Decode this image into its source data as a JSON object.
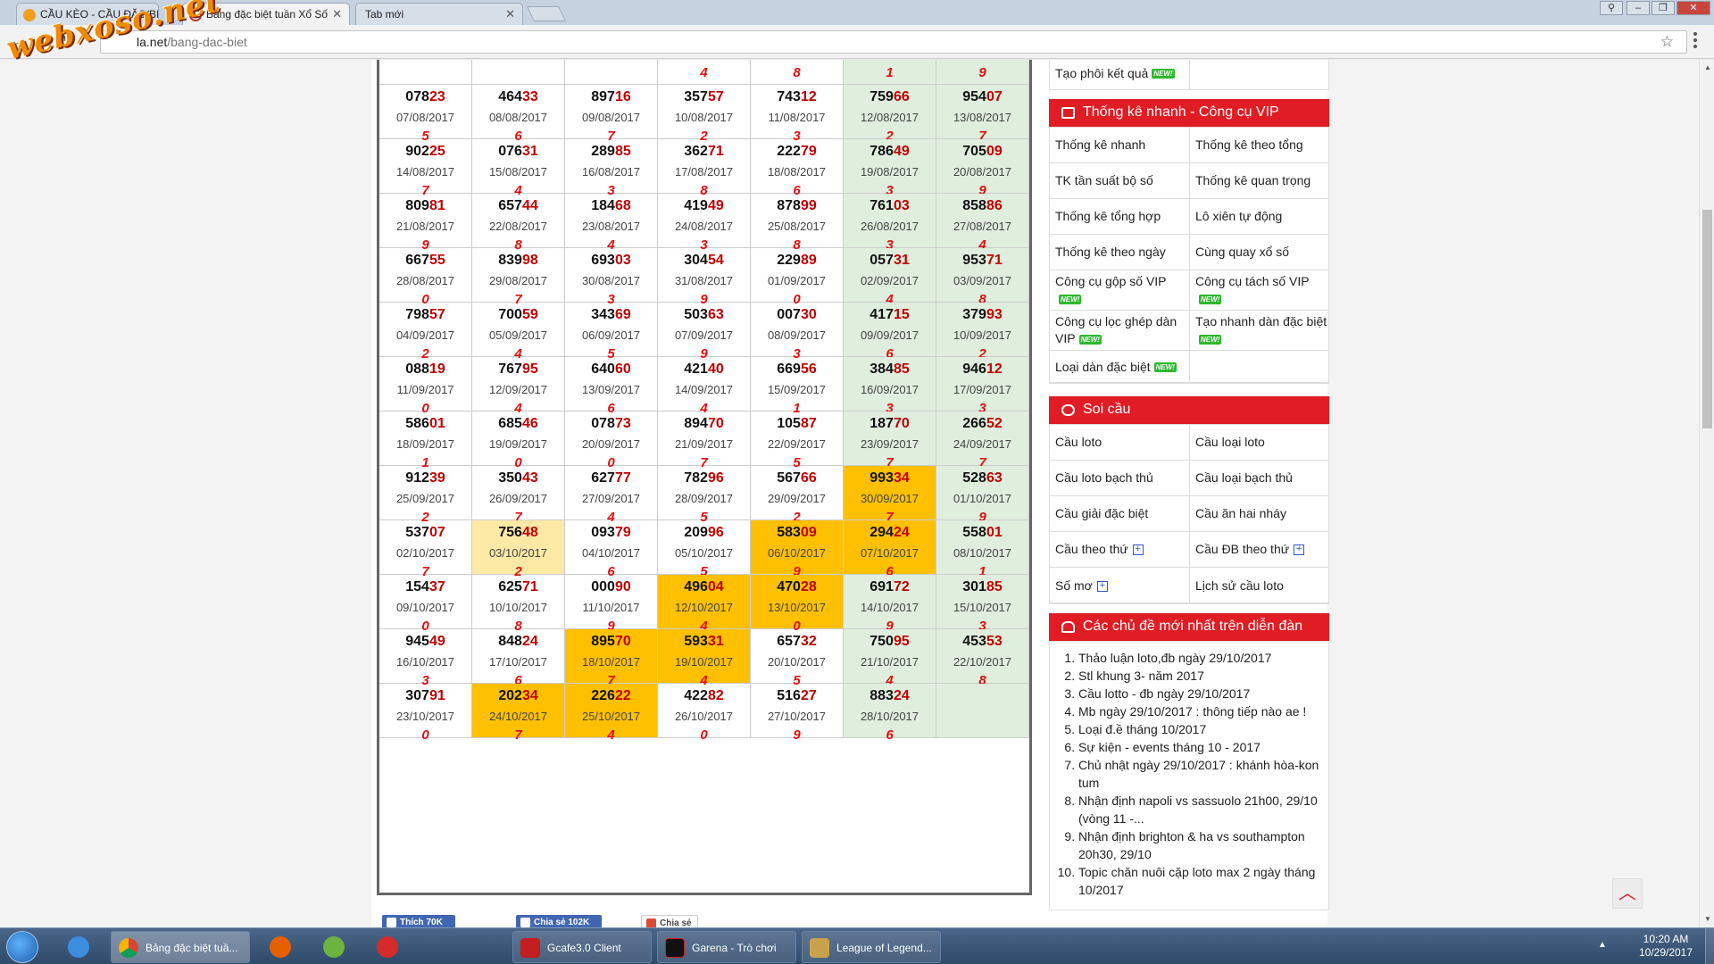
{
  "browser": {
    "tabs": [
      {
        "label": "CẦU KÈO - CẦU ĐẶC BIỆ"
      },
      {
        "label": "Bảng đặc biệt tuần Xổ Số"
      },
      {
        "label": "Tab mới"
      }
    ],
    "url_host": "la.net",
    "url_path": "/bang-dac-biet",
    "watermark": "webxoso.net"
  },
  "table": {
    "top_row_sums": [
      "4",
      "8",
      "1",
      "9"
    ],
    "rows": [
      [
        {
          "n": "07823",
          "d": "07/08/2017",
          "s": "5"
        },
        {
          "n": "46433",
          "d": "08/08/2017",
          "s": "6"
        },
        {
          "n": "89716",
          "d": "09/08/2017",
          "s": "7"
        },
        {
          "n": "35757",
          "d": "10/08/2017",
          "s": "2"
        },
        {
          "n": "74312",
          "d": "11/08/2017",
          "s": "3"
        },
        {
          "n": "75966",
          "d": "12/08/2017",
          "s": "2"
        },
        {
          "n": "95407",
          "d": "13/08/2017",
          "s": "7"
        }
      ],
      [
        {
          "n": "90225",
          "d": "14/08/2017",
          "s": "7"
        },
        {
          "n": "07631",
          "d": "15/08/2017",
          "s": "4"
        },
        {
          "n": "28985",
          "d": "16/08/2017",
          "s": "3"
        },
        {
          "n": "36271",
          "d": "17/08/2017",
          "s": "8"
        },
        {
          "n": "22279",
          "d": "18/08/2017",
          "s": "6"
        },
        {
          "n": "78649",
          "d": "19/08/2017",
          "s": "3"
        },
        {
          "n": "70509",
          "d": "20/08/2017",
          "s": "9"
        }
      ],
      [
        {
          "n": "80981",
          "d": "21/08/2017",
          "s": "9"
        },
        {
          "n": "65744",
          "d": "22/08/2017",
          "s": "8"
        },
        {
          "n": "18468",
          "d": "23/08/2017",
          "s": "4"
        },
        {
          "n": "41949",
          "d": "24/08/2017",
          "s": "3"
        },
        {
          "n": "87899",
          "d": "25/08/2017",
          "s": "8"
        },
        {
          "n": "76103",
          "d": "26/08/2017",
          "s": "3"
        },
        {
          "n": "85886",
          "d": "27/08/2017",
          "s": "4"
        }
      ],
      [
        {
          "n": "66755",
          "d": "28/08/2017",
          "s": "0"
        },
        {
          "n": "83998",
          "d": "29/08/2017",
          "s": "7"
        },
        {
          "n": "69303",
          "d": "30/08/2017",
          "s": "3"
        },
        {
          "n": "30454",
          "d": "31/08/2017",
          "s": "9"
        },
        {
          "n": "22989",
          "d": "01/09/2017",
          "s": "0"
        },
        {
          "n": "05731",
          "d": "02/09/2017",
          "s": "4"
        },
        {
          "n": "95371",
          "d": "03/09/2017",
          "s": "8"
        }
      ],
      [
        {
          "n": "79857",
          "d": "04/09/2017",
          "s": "2"
        },
        {
          "n": "70059",
          "d": "05/09/2017",
          "s": "4"
        },
        {
          "n": "34369",
          "d": "06/09/2017",
          "s": "5"
        },
        {
          "n": "50363",
          "d": "07/09/2017",
          "s": "9"
        },
        {
          "n": "00730",
          "d": "08/09/2017",
          "s": "3"
        },
        {
          "n": "41715",
          "d": "09/09/2017",
          "s": "6"
        },
        {
          "n": "37993",
          "d": "10/09/2017",
          "s": "2"
        }
      ],
      [
        {
          "n": "08819",
          "d": "11/09/2017",
          "s": "0"
        },
        {
          "n": "76795",
          "d": "12/09/2017",
          "s": "4"
        },
        {
          "n": "64060",
          "d": "13/09/2017",
          "s": "6"
        },
        {
          "n": "42140",
          "d": "14/09/2017",
          "s": "4"
        },
        {
          "n": "66956",
          "d": "15/09/2017",
          "s": "1"
        },
        {
          "n": "38485",
          "d": "16/09/2017",
          "s": "3"
        },
        {
          "n": "94612",
          "d": "17/09/2017",
          "s": "3"
        }
      ],
      [
        {
          "n": "58601",
          "d": "18/09/2017",
          "s": "1"
        },
        {
          "n": "68546",
          "d": "19/09/2017",
          "s": "0"
        },
        {
          "n": "07873",
          "d": "20/09/2017",
          "s": "0"
        },
        {
          "n": "89470",
          "d": "21/09/2017",
          "s": "7"
        },
        {
          "n": "10587",
          "d": "22/09/2017",
          "s": "5"
        },
        {
          "n": "18770",
          "d": "23/09/2017",
          "s": "7"
        },
        {
          "n": "26652",
          "d": "24/09/2017",
          "s": "7"
        }
      ],
      [
        {
          "n": "91239",
          "d": "25/09/2017",
          "s": "2"
        },
        {
          "n": "35043",
          "d": "26/09/2017",
          "s": "7"
        },
        {
          "n": "62777",
          "d": "27/09/2017",
          "s": "4"
        },
        {
          "n": "78296",
          "d": "28/09/2017",
          "s": "5"
        },
        {
          "n": "56766",
          "d": "29/09/2017",
          "s": "2"
        },
        {
          "n": "99334",
          "d": "30/09/2017",
          "s": "7",
          "hl": "hl"
        },
        {
          "n": "52863",
          "d": "01/10/2017",
          "s": "9"
        }
      ],
      [
        {
          "n": "53707",
          "d": "02/10/2017",
          "s": "7"
        },
        {
          "n": "75648",
          "d": "03/10/2017",
          "s": "2",
          "hl": "lt"
        },
        {
          "n": "09379",
          "d": "04/10/2017",
          "s": "6"
        },
        {
          "n": "20996",
          "d": "05/10/2017",
          "s": "5"
        },
        {
          "n": "58309",
          "d": "06/10/2017",
          "s": "9",
          "hl": "hl"
        },
        {
          "n": "29424",
          "d": "07/10/2017",
          "s": "6",
          "hl": "hl"
        },
        {
          "n": "55801",
          "d": "08/10/2017",
          "s": "1"
        }
      ],
      [
        {
          "n": "15437",
          "d": "09/10/2017",
          "s": "0"
        },
        {
          "n": "62571",
          "d": "10/10/2017",
          "s": "8"
        },
        {
          "n": "00090",
          "d": "11/10/2017",
          "s": "9"
        },
        {
          "n": "49604",
          "d": "12/10/2017",
          "s": "4",
          "hl": "hl"
        },
        {
          "n": "47028",
          "d": "13/10/2017",
          "s": "0",
          "hl": "hl"
        },
        {
          "n": "69172",
          "d": "14/10/2017",
          "s": "9"
        },
        {
          "n": "30185",
          "d": "15/10/2017",
          "s": "3"
        }
      ],
      [
        {
          "n": "94549",
          "d": "16/10/2017",
          "s": "3"
        },
        {
          "n": "84824",
          "d": "17/10/2017",
          "s": "6"
        },
        {
          "n": "89570",
          "d": "18/10/2017",
          "s": "7",
          "hl": "hl"
        },
        {
          "n": "59331",
          "d": "19/10/2017",
          "s": "4",
          "hl": "hl"
        },
        {
          "n": "65732",
          "d": "20/10/2017",
          "s": "5"
        },
        {
          "n": "75095",
          "d": "21/10/2017",
          "s": "4"
        },
        {
          "n": "45353",
          "d": "22/10/2017",
          "s": "8"
        }
      ],
      [
        {
          "n": "30791",
          "d": "23/10/2017",
          "s": "0"
        },
        {
          "n": "20234",
          "d": "24/10/2017",
          "s": "7",
          "hl": "hl"
        },
        {
          "n": "22622",
          "d": "25/10/2017",
          "s": "4",
          "hl": "hl"
        },
        {
          "n": "42282",
          "d": "26/10/2017",
          "s": "0"
        },
        {
          "n": "51627",
          "d": "27/10/2017",
          "s": "9"
        },
        {
          "n": "88324",
          "d": "28/10/2017",
          "s": "6"
        },
        {
          "n": "",
          "d": "",
          "s": ""
        }
      ]
    ]
  },
  "social": {
    "like": "Thích 70K",
    "share_fb": "Chia sẻ 102K",
    "share_g": "Chia sẻ"
  },
  "sidebar": {
    "top_item": "Tạo phôi kết quả",
    "new_badge": "NEW!",
    "stats": {
      "title": "Thống kê nhanh - Công cụ VIP",
      "items": [
        "Thống kê nhanh",
        "Thống kê theo tổng",
        "TK tần suất bộ số",
        "Thống kê quan trọng",
        "Thống kê tổng hợp",
        "Lô xiên tự động",
        "Thống kê theo ngày",
        "Cùng quay xổ số",
        "Công cụ gộp số VIP",
        "Công cụ tách số VIP",
        "Công cụ lọc ghép dàn VIP",
        "Tạo nhanh dàn đặc biệt",
        "Loại dàn đặc biệt",
        ""
      ]
    },
    "soicau": {
      "title": "Soi cầu",
      "items": [
        "Cầu loto",
        "Cầu loại loto",
        "Cầu loto bạch thủ",
        "Cầu loại bạch thủ",
        "Cầu giải đặc biệt",
        "Cầu ăn hai nháy",
        "Cầu theo thứ",
        "Cầu ĐB theo thứ",
        "Số mơ",
        "Lịch sử cầu loto"
      ]
    },
    "forum": {
      "title": "Các chủ đề mới nhất trên diễn đàn",
      "items": [
        "Thảo luận loto,đb ngày 29/10/2017",
        "Stl khung 3- năm 2017",
        "Cầu lotto - đb ngày 29/10/2017",
        "Mb ngày 29/10/2017 : thông tiếp nào ae !",
        "Loại đ.ề tháng 10/2017",
        "Sự kiện - events tháng 10 - 2017",
        "Chủ nhật ngày 29/10/2017 : khánh hòa-kon tum",
        "Nhận định napoli vs sassuolo 21h00, 29/10 (vòng 11 -...",
        "Nhận định brighton & ha vs southampton 20h30, 29/10",
        "Topic chăn nuôi cặp loto max 2 ngày tháng 10/2017"
      ]
    }
  },
  "taskbar": {
    "tasks": [
      "Bảng đặc biệt tuầ...",
      "Gcafe3.0 Client",
      "Garena - Trò chơi",
      "League of Legend..."
    ],
    "time": "10:20 AM",
    "date": "10/29/2017"
  },
  "colors": {
    "accent_red": "#e01c24",
    "highlight": "#fec000",
    "highlight_light": "#fde9a6",
    "weekend_green": "#dfeedd"
  }
}
